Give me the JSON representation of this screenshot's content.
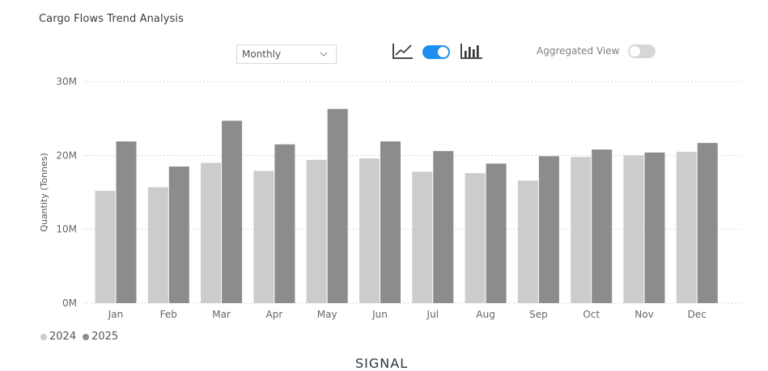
{
  "title": "Cargo Flows Trend Analysis",
  "controls": {
    "period_value": "Monthly",
    "line_icon": "line-chart-icon",
    "bar_icon": "bar-chart-icon",
    "chart_toggle_on": true,
    "aggregated_label": "Aggregated View",
    "aggregated_on": false
  },
  "colors": {
    "series_2024": "#cccccc",
    "series_2025": "#8c8c8c",
    "toggle_on": "#1f8ef1",
    "toggle_off": "#d6d6d6"
  },
  "brand": "SIGNAL",
  "chart_data": {
    "type": "bar",
    "categories": [
      "Jan",
      "Feb",
      "Mar",
      "Apr",
      "May",
      "Jun",
      "Jul",
      "Aug",
      "Sep",
      "Oct",
      "Nov",
      "Dec"
    ],
    "series": [
      {
        "name": "2024",
        "values": [
          15.2,
          15.7,
          19.0,
          17.9,
          19.4,
          19.6,
          17.8,
          17.6,
          16.6,
          19.8,
          20.0,
          20.5
        ]
      },
      {
        "name": "2025",
        "values": [
          21.9,
          18.5,
          24.7,
          21.5,
          26.3,
          21.9,
          20.6,
          18.9,
          19.9,
          20.8,
          20.4,
          21.7
        ]
      }
    ],
    "value_unit": "M",
    "ylabel": "Quantity (Tonnes)",
    "xlabel": "",
    "ylim": [
      0,
      30
    ],
    "yticks": [
      "0M",
      "10M",
      "20M",
      "30M"
    ],
    "grid": true,
    "legend_position": "bottom-left"
  }
}
